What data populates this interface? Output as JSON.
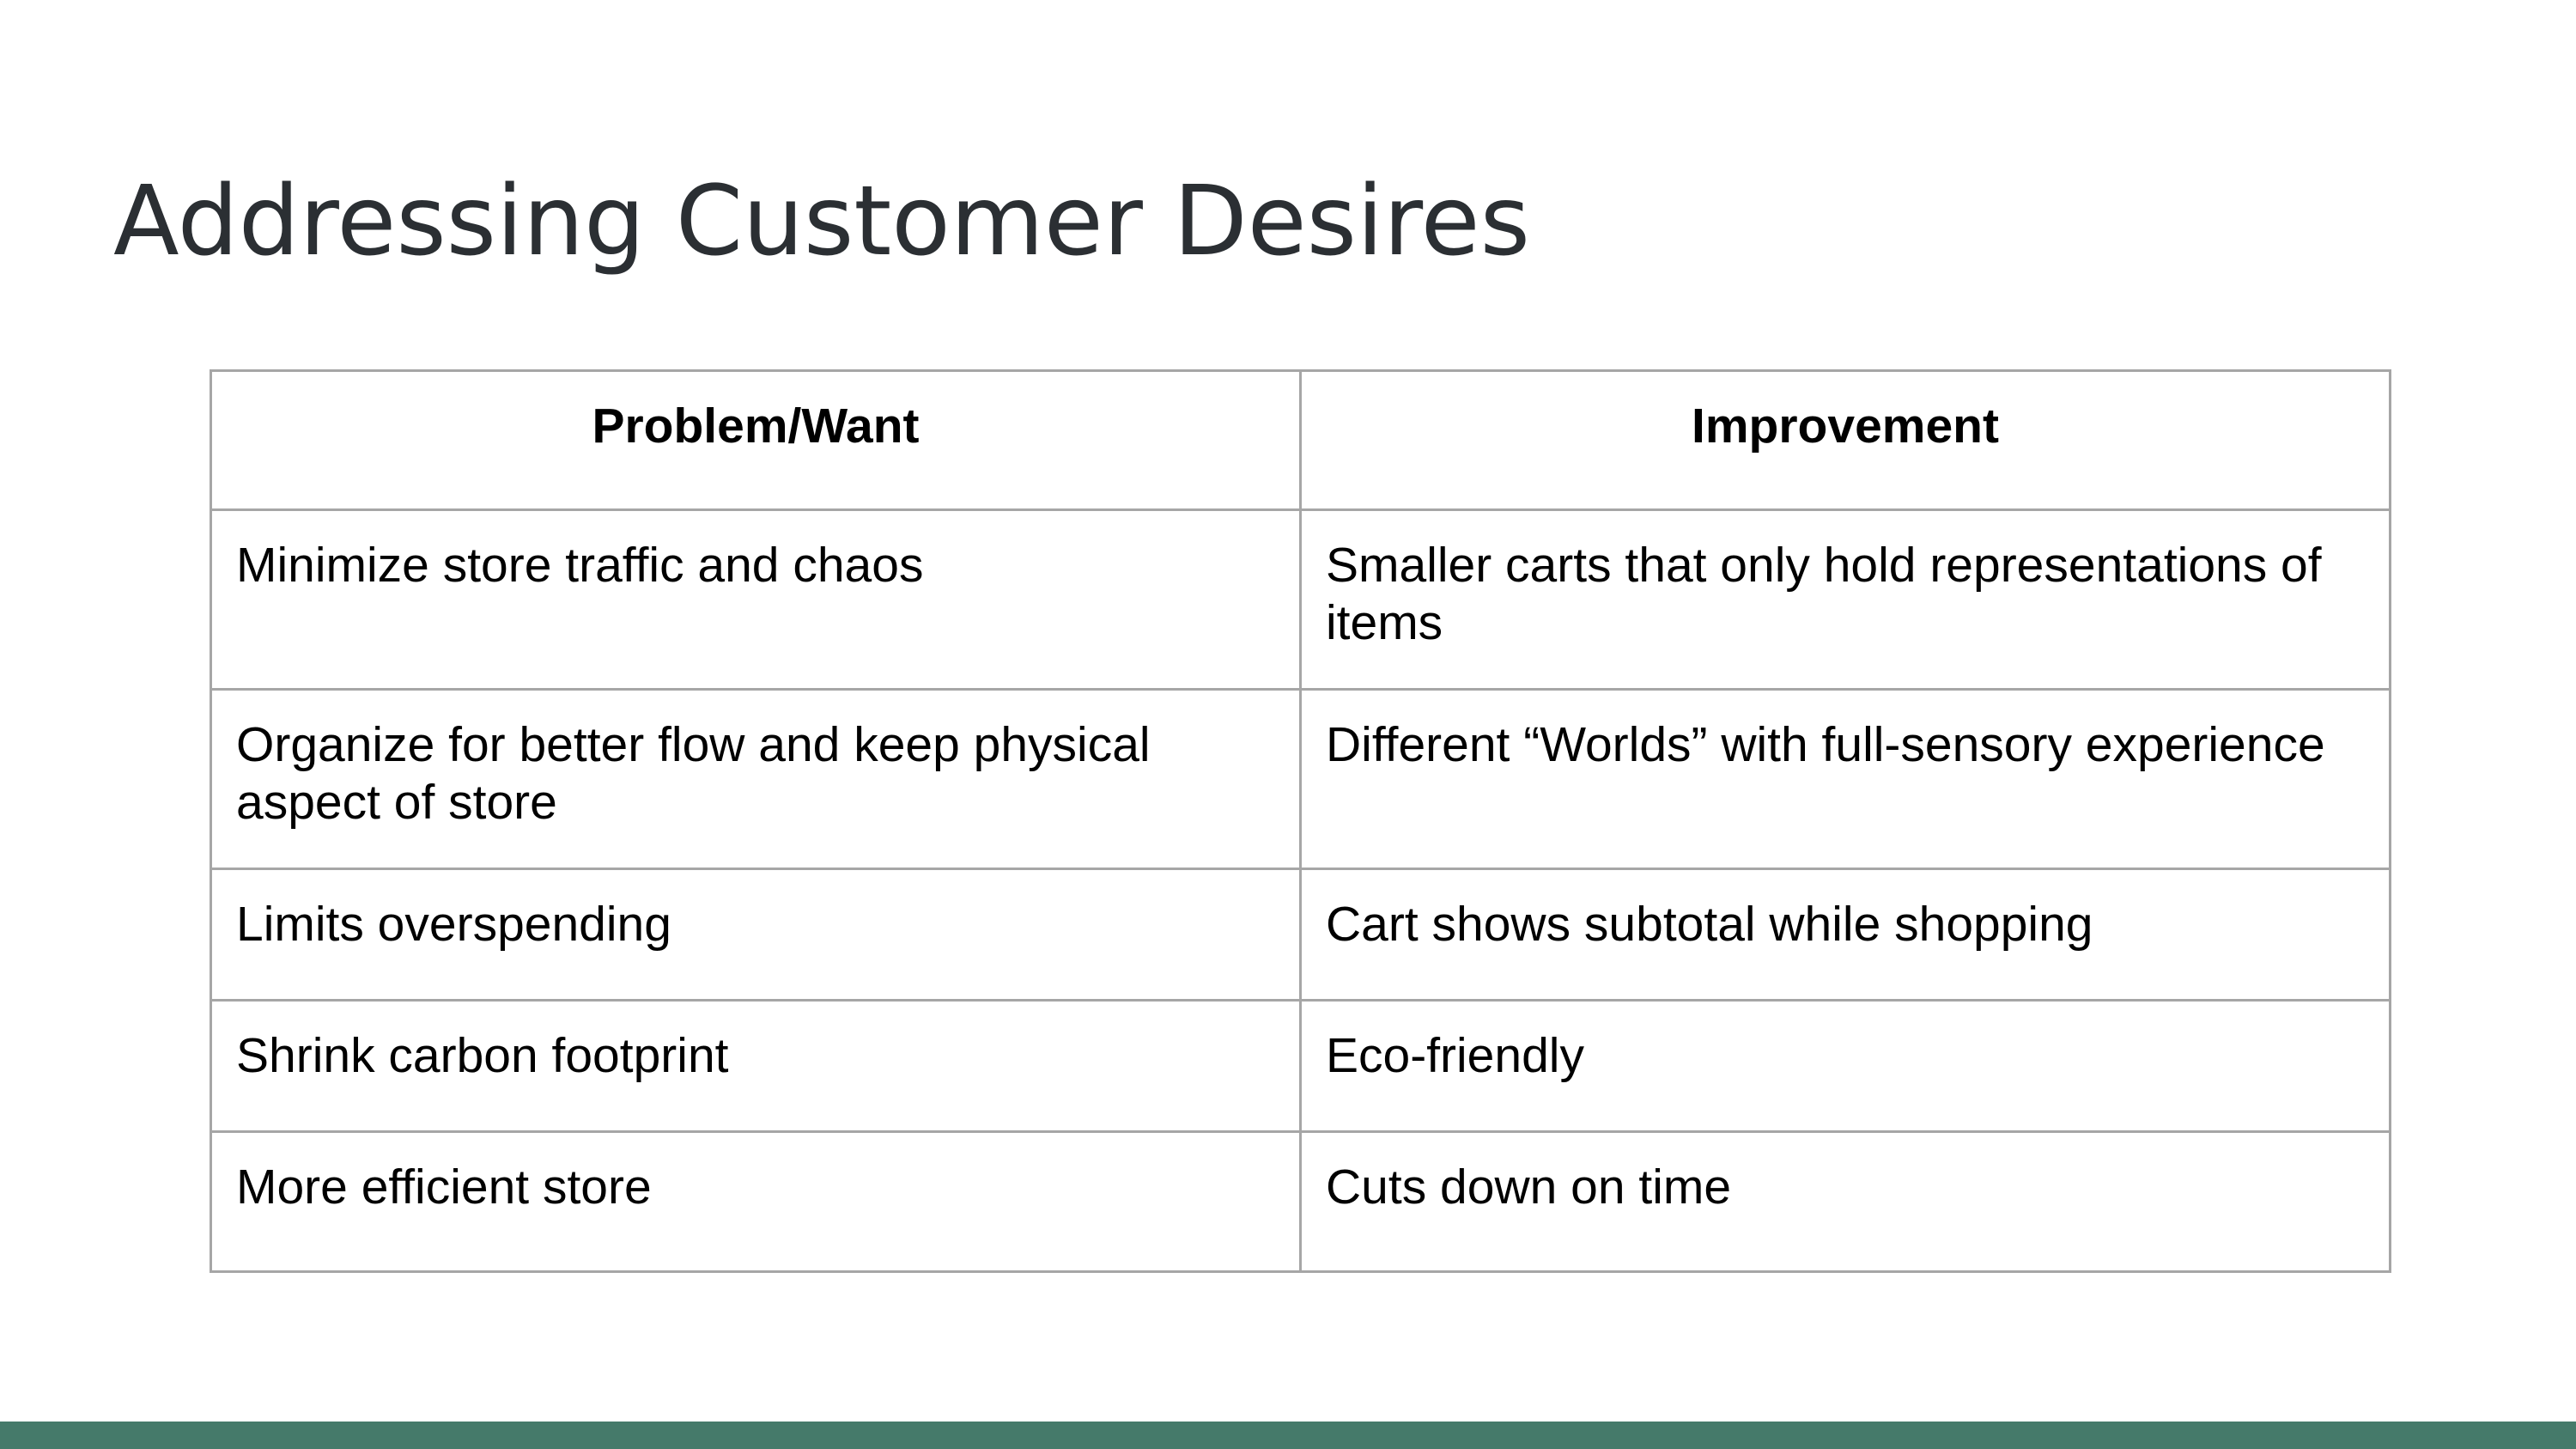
{
  "slide": {
    "title": "Addressing Customer Desires"
  },
  "table": {
    "headers": [
      "Problem/Want",
      "Improvement"
    ],
    "rows": [
      [
        "Minimize store traffic and chaos",
        "Smaller carts that only hold representations of items"
      ],
      [
        "Organize for better flow and keep physical aspect of store",
        "Different “Worlds” with full-sensory experience"
      ],
      [
        "Limits overspending",
        "Cart shows subtotal while shopping"
      ],
      [
        "Shrink carbon footprint",
        "Eco-friendly"
      ],
      [
        "More efficient store",
        "Cuts down on time"
      ]
    ]
  },
  "colors": {
    "title_text": "#2b2f33",
    "table_border": "#a6a6a6",
    "footer_bar": "#457a6a"
  }
}
